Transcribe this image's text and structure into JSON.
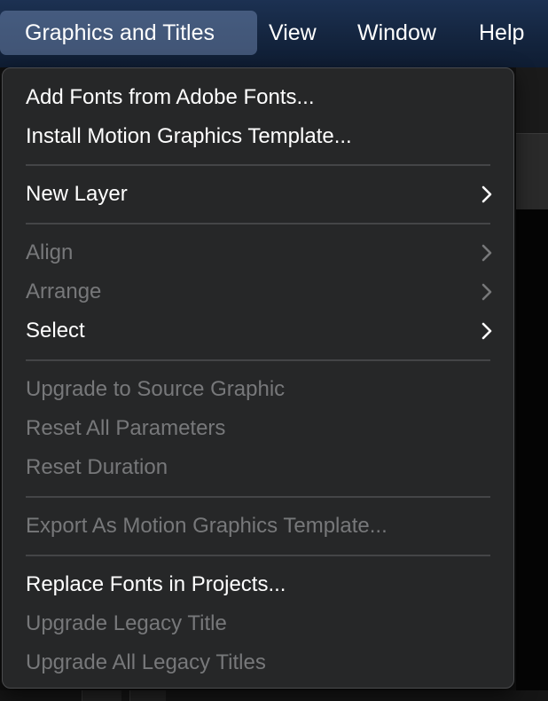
{
  "menubar": {
    "items": [
      {
        "label": "Graphics and Titles",
        "active": true
      },
      {
        "label": "View"
      },
      {
        "label": "Window"
      },
      {
        "label": "Help"
      }
    ]
  },
  "menu": {
    "items": {
      "add_fonts": {
        "label": "Add Fonts from Adobe Fonts...",
        "enabled": true
      },
      "install_mogrt": {
        "label": "Install Motion Graphics Template...",
        "enabled": true
      },
      "new_layer": {
        "label": "New Layer",
        "enabled": true,
        "submenu": true
      },
      "align": {
        "label": "Align",
        "enabled": false,
        "submenu": true
      },
      "arrange": {
        "label": "Arrange",
        "enabled": false,
        "submenu": true
      },
      "select": {
        "label": "Select",
        "enabled": true,
        "submenu": true
      },
      "upgrade_source": {
        "label": "Upgrade to Source Graphic",
        "enabled": false
      },
      "reset_params": {
        "label": "Reset All Parameters",
        "enabled": false
      },
      "reset_duration": {
        "label": "Reset Duration",
        "enabled": false
      },
      "export_mogrt": {
        "label": "Export As Motion Graphics Template...",
        "enabled": false
      },
      "replace_fonts": {
        "label": "Replace Fonts in Projects...",
        "enabled": true
      },
      "upgrade_legacy": {
        "label": "Upgrade Legacy Title",
        "enabled": false
      },
      "upgrade_all_legacy": {
        "label": "Upgrade All Legacy Titles",
        "enabled": false
      }
    }
  },
  "colors": {
    "menubar_bg": "#14253f",
    "menu_bg": "#262728",
    "enabled_text": "#ffffff",
    "disabled_text": "#77787a",
    "separator": "#444547",
    "active_highlight": "#5a6f92"
  },
  "icons": {
    "submenu": "chevron-right-icon"
  }
}
